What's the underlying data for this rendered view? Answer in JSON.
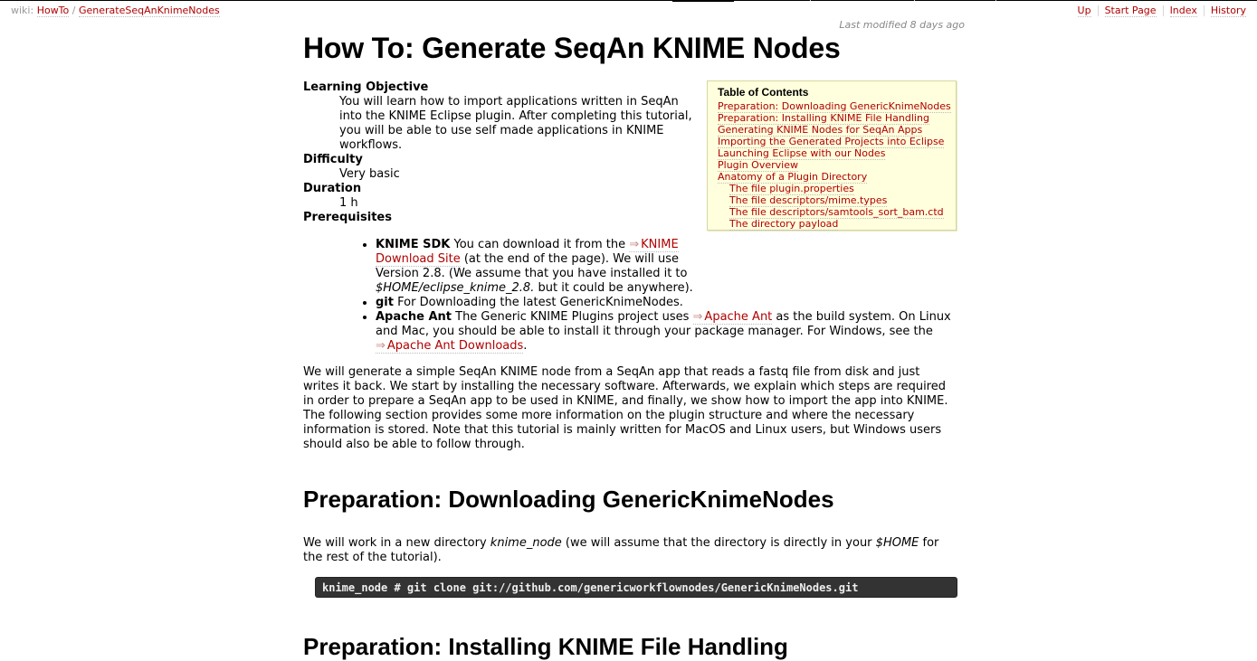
{
  "nav": {
    "wiki_label": "wiki:",
    "crumbs": [
      "HowTo",
      "GenerateSeqAnKnimeNodes"
    ],
    "crumb_sep": "/",
    "links": [
      "Up",
      "Start Page",
      "Index",
      "History"
    ]
  },
  "last_modified": "Last modified 8 days ago",
  "title": "How To: Generate SeqAn KNIME Nodes",
  "meta": {
    "objective_label": "Learning Objective",
    "objective_text": "You will learn how to import applications written in SeqAn into the KNIME Eclipse plugin. After completing this tutorial, you will be able to use self made applications in KNIME workflows.",
    "difficulty_label": "Difficulty",
    "difficulty_text": "Very basic",
    "duration_label": "Duration",
    "duration_text": "1 h",
    "prereq_label": "Prerequisites"
  },
  "toc": {
    "title": "Table of Contents",
    "items": [
      "Preparation: Downloading GenericKnimeNodes",
      "Preparation: Installing KNIME File Handling",
      "Generating KNIME Nodes for SeqAn Apps",
      "Importing the Generated Projects into Eclipse",
      "Launching Eclipse with our Nodes",
      "Plugin Overview",
      "Anatomy of a Plugin Directory"
    ],
    "subitems": [
      "The file plugin.properties",
      "The file descriptors/mime.types",
      "The file descriptors/samtools_sort_bam.ctd",
      "The directory payload"
    ]
  },
  "prereqs": {
    "sdk_name": "KNIME SDK",
    "sdk_text1": "You can download it from the",
    "sdk_link": "KNIME Download Site",
    "sdk_text2": "(at the end of the page). We will use Version 2.8. (We assume that you have installed it to",
    "sdk_path": "$HOME/eclipse_knime_2.8.",
    "sdk_text3": "but it could be anywhere).",
    "git_name": "git",
    "git_text": "For Downloading the latest GenericKnimeNodes.",
    "ant_name": "Apache Ant",
    "ant_text1": "The Generic KNIME Plugins project uses",
    "ant_link": "Apache Ant",
    "ant_text2": "as the build system. On Linux and Mac, you should be able to install it through your package manager. For Windows, see the",
    "ant_link2": "Apache Ant Downloads",
    "ant_text3": "."
  },
  "intro": "We will generate a simple SeqAn KNIME node from a SeqAn app that reads a fastq file from disk and just writes it back. We start by installing the necessary software. Afterwards, we explain which steps are required in order to prepare a SeqAn app to be used in KNIME, and finally, we show how to import the app into KNIME. The following section provides some more information on the plugin structure and where the necessary information is stored. Note that this tutorial is mainly written for MacOS and Linux users, but Windows users should also be able to follow through.",
  "section1": {
    "heading": "Preparation: Downloading GenericKnimeNodes",
    "text1": "We will work in a new directory",
    "dir": "knime_node",
    "text2": "(we will assume that the directory is directly in your",
    "home": "$HOME",
    "text3": "for the rest of the tutorial).",
    "code": "knime_node # git clone git://github.com/genericworkflownodes/GenericKnimeNodes.git"
  },
  "section2": {
    "heading": "Preparation: Installing KNIME File Handling"
  }
}
